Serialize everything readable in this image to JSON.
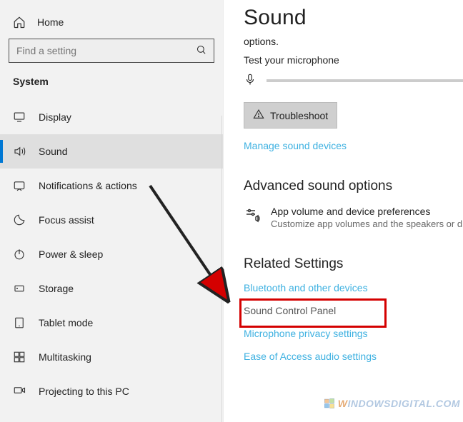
{
  "sidebar": {
    "home_label": "Home",
    "search_placeholder": "Find a setting",
    "section_title": "System",
    "items": [
      {
        "label": "Display"
      },
      {
        "label": "Sound"
      },
      {
        "label": "Notifications & actions"
      },
      {
        "label": "Focus assist"
      },
      {
        "label": "Power & sleep"
      },
      {
        "label": "Storage"
      },
      {
        "label": "Tablet mode"
      },
      {
        "label": "Multitasking"
      },
      {
        "label": "Projecting to this PC"
      }
    ]
  },
  "main": {
    "title": "Sound",
    "subtext": "options.",
    "test_label": "Test your microphone",
    "troubleshoot": "Troubleshoot",
    "manage_link": "Manage sound devices",
    "advanced_heading": "Advanced sound options",
    "pref_title": "App volume and device preferences",
    "pref_sub": "Customize app volumes and the speakers or d",
    "related_heading": "Related Settings",
    "related_links": [
      "Bluetooth and other devices",
      "Sound Control Panel",
      "Microphone privacy settings",
      "Ease of Access audio settings"
    ]
  },
  "watermark": {
    "w": "W",
    "text": "INDOWSDIGITAL.COM"
  }
}
